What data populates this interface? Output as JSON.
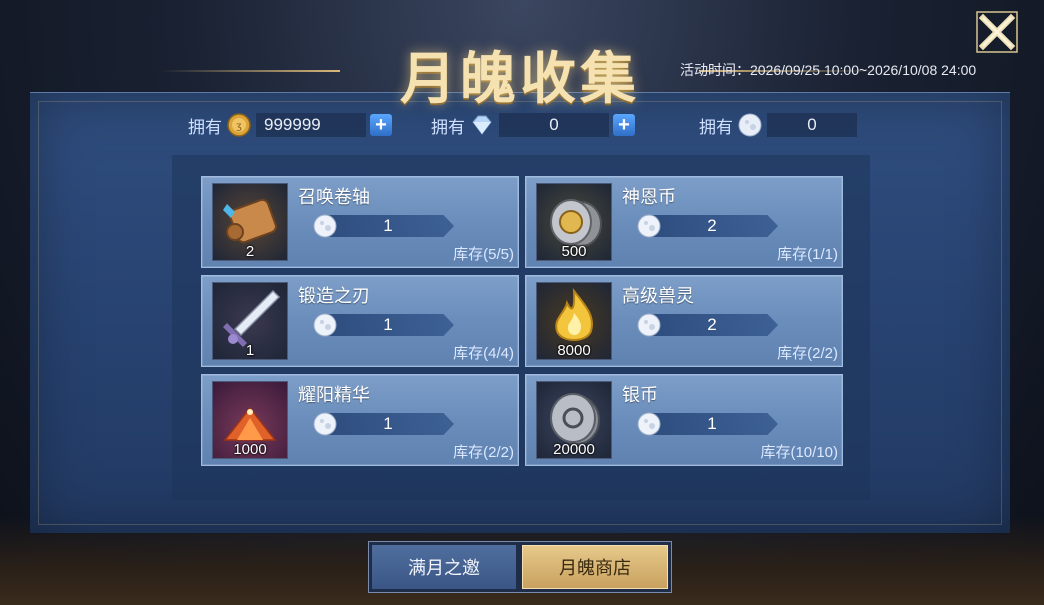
{
  "header": {
    "title": "月魄收集",
    "event_time": "活动时间：2026/09/25 10:00~2026/10/08 24:00"
  },
  "currencies": [
    {
      "label": "拥有",
      "icon": "gold-coin-icon",
      "value": "999999",
      "has_plus": true
    },
    {
      "label": "拥有",
      "icon": "diamond-icon",
      "value": "0",
      "has_plus": true
    },
    {
      "label": "拥有",
      "icon": "moon-soul-icon",
      "value": "0",
      "has_plus": false
    }
  ],
  "items": [
    {
      "name": "召唤卷轴",
      "thumb_qty": "2",
      "price": "1",
      "stock": "库存(5/5)",
      "icon": "scroll-icon"
    },
    {
      "name": "神恩币",
      "thumb_qty": "500",
      "price": "2",
      "stock": "库存(1/1)",
      "icon": "silver-coin-stack-icon"
    },
    {
      "name": "锻造之刃",
      "thumb_qty": "1",
      "price": "1",
      "stock": "库存(4/4)",
      "icon": "blade-icon"
    },
    {
      "name": "高级兽灵",
      "thumb_qty": "8000",
      "price": "2",
      "stock": "库存(2/2)",
      "icon": "flame-spirit-icon"
    },
    {
      "name": "耀阳精华",
      "thumb_qty": "1000",
      "price": "1",
      "stock": "库存(2/2)",
      "icon": "crystal-pile-icon"
    },
    {
      "name": "银币",
      "thumb_qty": "20000",
      "price": "1",
      "stock": "库存(10/10)",
      "icon": "silver-coin-icon"
    }
  ],
  "tabs": [
    {
      "label": "满月之邀",
      "active": false
    },
    {
      "label": "月魄商店",
      "active": true
    }
  ],
  "colors": {
    "panel": "#2f4d7e",
    "card": "#6a8dbb",
    "title_gold": "#f6e2b0",
    "active_tab": "#d9b878"
  }
}
